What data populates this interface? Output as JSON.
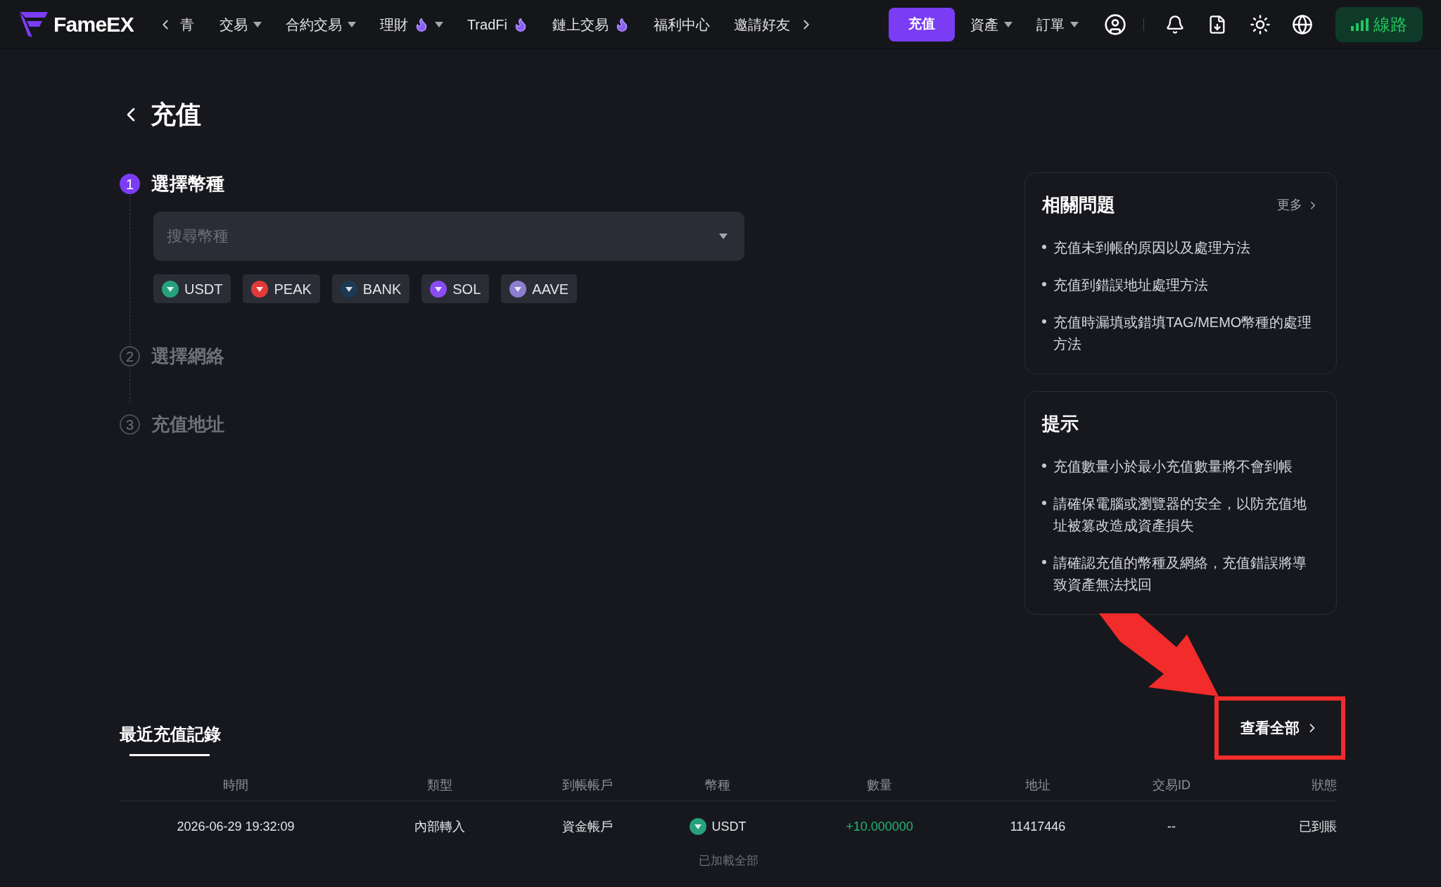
{
  "nav": {
    "logo": "FameEX",
    "cut_item": "青",
    "items": [
      {
        "label": "交易",
        "dropdown": true,
        "hot": false
      },
      {
        "label": "合約交易",
        "dropdown": true,
        "hot": false
      },
      {
        "label": "理財",
        "dropdown": true,
        "hot": true
      },
      {
        "label": "TradFi",
        "dropdown": false,
        "hot": true
      },
      {
        "label": "鏈上交易",
        "dropdown": false,
        "hot": true
      },
      {
        "label": "福利中心",
        "dropdown": false,
        "hot": false
      },
      {
        "label": "邀請好友",
        "dropdown": false,
        "hot": false
      }
    ],
    "deposit_button": "充值",
    "menus": [
      {
        "label": "資產"
      },
      {
        "label": "訂單"
      }
    ],
    "line_button": "線路"
  },
  "page_title": "充值",
  "steps": [
    {
      "number": "1",
      "label": "選擇幣種",
      "active": true
    },
    {
      "number": "2",
      "label": "選擇網絡",
      "active": false
    },
    {
      "number": "3",
      "label": "充值地址",
      "active": false
    }
  ],
  "search": {
    "placeholder": "搜尋幣種"
  },
  "coins": [
    {
      "symbol": "USDT",
      "color": "#26a17b"
    },
    {
      "symbol": "PEAK",
      "color": "#e03a3a"
    },
    {
      "symbol": "BANK",
      "color": "#1d3a55"
    },
    {
      "symbol": "SOL",
      "color": "#8a4cf0"
    },
    {
      "symbol": "AAVE",
      "color": "#8c7fd0"
    }
  ],
  "faq": {
    "title": "相關問題",
    "more": "更多",
    "items": [
      "充值未到帳的原因以及處理方法",
      "充值到錯誤地址處理方法",
      "充值時漏填或錯填TAG/MEMO幣種的處理方法"
    ]
  },
  "tips": {
    "title": "提示",
    "items": [
      "充值數量小於最小充值數量將不會到帳",
      "請確保電腦或瀏覽器的安全，以防充值地址被篡改造成資產損失",
      "請確認充值的幣種及網絡，充值錯誤將導致資產無法找回"
    ]
  },
  "records": {
    "title": "最近充值記錄",
    "view_all": "查看全部",
    "columns": [
      "時間",
      "類型",
      "到帳帳戶",
      "幣種",
      "數量",
      "地址",
      "交易ID",
      "狀態"
    ],
    "rows": [
      {
        "time": "2026-06-29 19:32:09",
        "type": "內部轉入",
        "account": "資金帳戶",
        "coin": "USDT",
        "color": "#26a17b",
        "amount": "+10.000000",
        "address": "11417446",
        "txid": "--",
        "status": "已到賬"
      }
    ],
    "footer": "已加載全部"
  }
}
